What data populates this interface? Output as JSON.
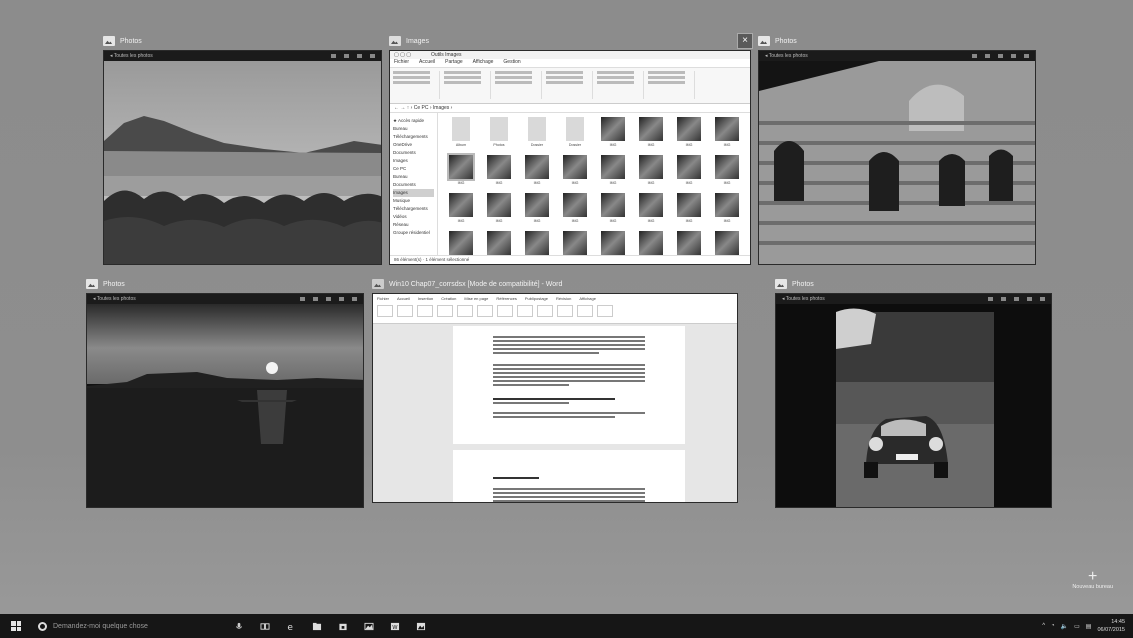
{
  "windows": [
    {
      "id": "photos-1",
      "title": "Photos",
      "image": "lake-mountains-landscape"
    },
    {
      "id": "explorer",
      "title": "Images",
      "image": "file-explorer-images-folder"
    },
    {
      "id": "photos-2",
      "title": "Photos",
      "image": "church-facade"
    },
    {
      "id": "photos-3",
      "title": "Photos",
      "image": "sunset-sea"
    },
    {
      "id": "word",
      "title": "Win10 Chap07_corrsdsx [Mode de compatibilité] - Word",
      "image": "word-document"
    },
    {
      "id": "photos-4",
      "title": "Photos",
      "image": "vintage-car"
    }
  ],
  "close_button": "×",
  "new_desktop_label": "Nouveau bureau",
  "taskbar": {
    "search_placeholder": "Demandez-moi quelque chose",
    "icons": [
      "microphone-icon",
      "task-view-icon",
      "edge-icon",
      "file-explorer-icon",
      "store-icon",
      "photos-icon",
      "word-icon",
      "images-icon"
    ],
    "clock_time": "14:45",
    "clock_date": "06/07/2015"
  }
}
